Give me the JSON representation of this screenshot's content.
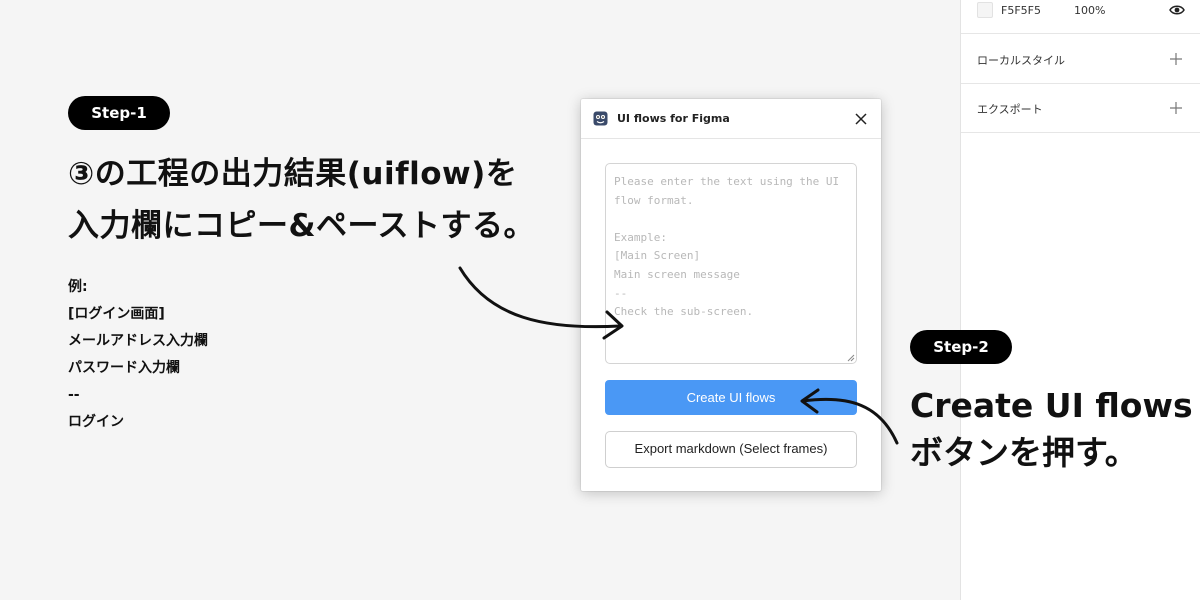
{
  "right_panel": {
    "fill": {
      "hex": "F5F5F5",
      "opacity": "100%",
      "swatch_color": "#F5F5F5"
    },
    "sections": [
      {
        "label": "ローカルスタイル",
        "icon": "plus-icon"
      },
      {
        "label": "エクスポート",
        "icon": "plus-icon"
      }
    ]
  },
  "step1": {
    "badge": "Step-1",
    "heading_lines": [
      "③の工程の出力結果(uiflow)を",
      "入力欄にコピー&ペーストする。"
    ],
    "example_lines": [
      "例:",
      "[ログイン画面]",
      "メールアドレス入力欄",
      "パスワード入力欄",
      "--",
      "ログイン"
    ]
  },
  "step2": {
    "badge": "Step-2",
    "text_lines": [
      "Create UI flows",
      "ボタンを押す。"
    ]
  },
  "plugin": {
    "title": "UI flows for Figma",
    "textarea_placeholder": "Please enter the text using the UI\nflow format.\n\nExample:\n[Main Screen]\nMain screen message\n--\nCheck the sub-screen.",
    "create_button": "Create UI flows",
    "export_button": "Export markdown (Select frames)",
    "accent_color": "#4A98F5"
  }
}
